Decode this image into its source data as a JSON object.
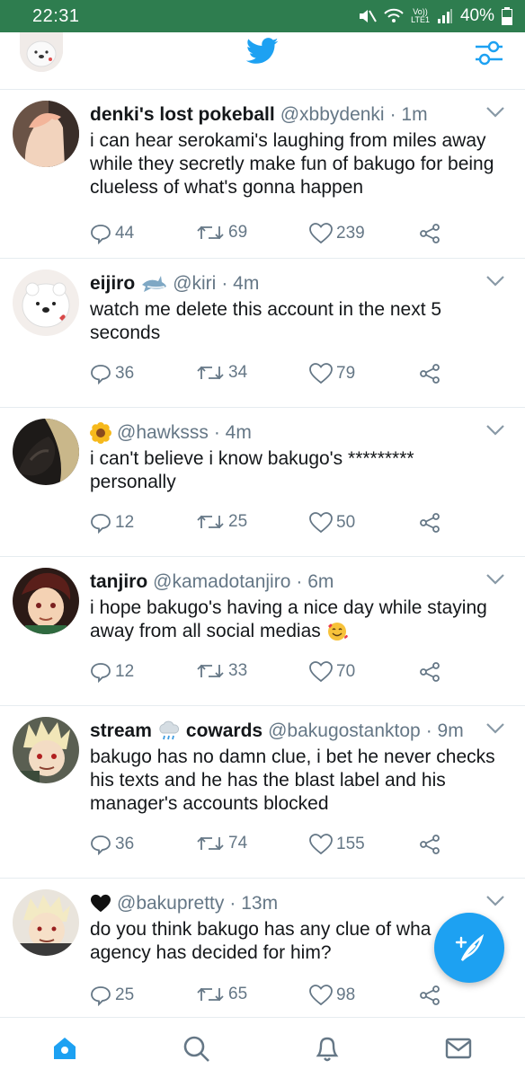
{
  "status_bar": {
    "time": "22:31",
    "network_label_top": "Vo))",
    "network_label_bottom": "LTE1",
    "battery": "40%"
  },
  "header": {
    "logo_icon": "twitter-bird-icon",
    "settings_icon": "sliders-icon",
    "accent_color": "#1da1f2"
  },
  "tweets": [
    {
      "name": "denki's lost pokeball",
      "handle": "@xbbydenki",
      "time": "· 1m",
      "text": "i can hear serokami's laughing from miles away while they secretly make fun of bakugo for being clueless of what's gonna happen",
      "replies": "44",
      "retweets": "69",
      "likes": "239"
    },
    {
      "name": "eijiro",
      "name_emoji": "shark-emoji",
      "handle": "@kiri",
      "time": "· 4m",
      "text": "watch me delete this account in the next 5 seconds",
      "replies": "36",
      "retweets": "34",
      "likes": "79"
    },
    {
      "name_emoji": "sunflower-emoji",
      "handle": "@hawksss",
      "time": "· 4m",
      "text": "i can't believe i know bakugo's ********* personally",
      "replies": "12",
      "retweets": "25",
      "likes": "50"
    },
    {
      "name": "tanjiro",
      "handle": "@kamadotanjiro",
      "time": "· 6m",
      "text": "i hope bakugo's having a nice day while staying away from all social medias",
      "text_emoji": "smiling-face-with-hearts-emoji",
      "replies": "12",
      "retweets": "33",
      "likes": "70"
    },
    {
      "name_part1": "stream",
      "name_emoji": "cloud-with-rain-emoji",
      "name_part2": "cowards",
      "handle": "@bakugostanktop",
      "time": "· 9m",
      "text": "bakugo has no damn clue, i bet he never checks his texts and he has the blast label and his manager's accounts blocked",
      "replies": "36",
      "retweets": "74",
      "likes": "155"
    },
    {
      "name_emoji": "black-heart-emoji",
      "handle": "@bakupretty",
      "time": "· 13m",
      "text": "do you think bakugo has any clue of wha",
      "text_line2": "agency has decided for him?",
      "replies": "25",
      "retweets": "65",
      "likes": "98"
    }
  ],
  "fab": {
    "icon": "compose-feather-icon"
  },
  "bottom_nav": {
    "items": [
      "home-icon",
      "search-icon",
      "notifications-bell-icon",
      "messages-envelope-icon"
    ],
    "active": "home-icon"
  }
}
